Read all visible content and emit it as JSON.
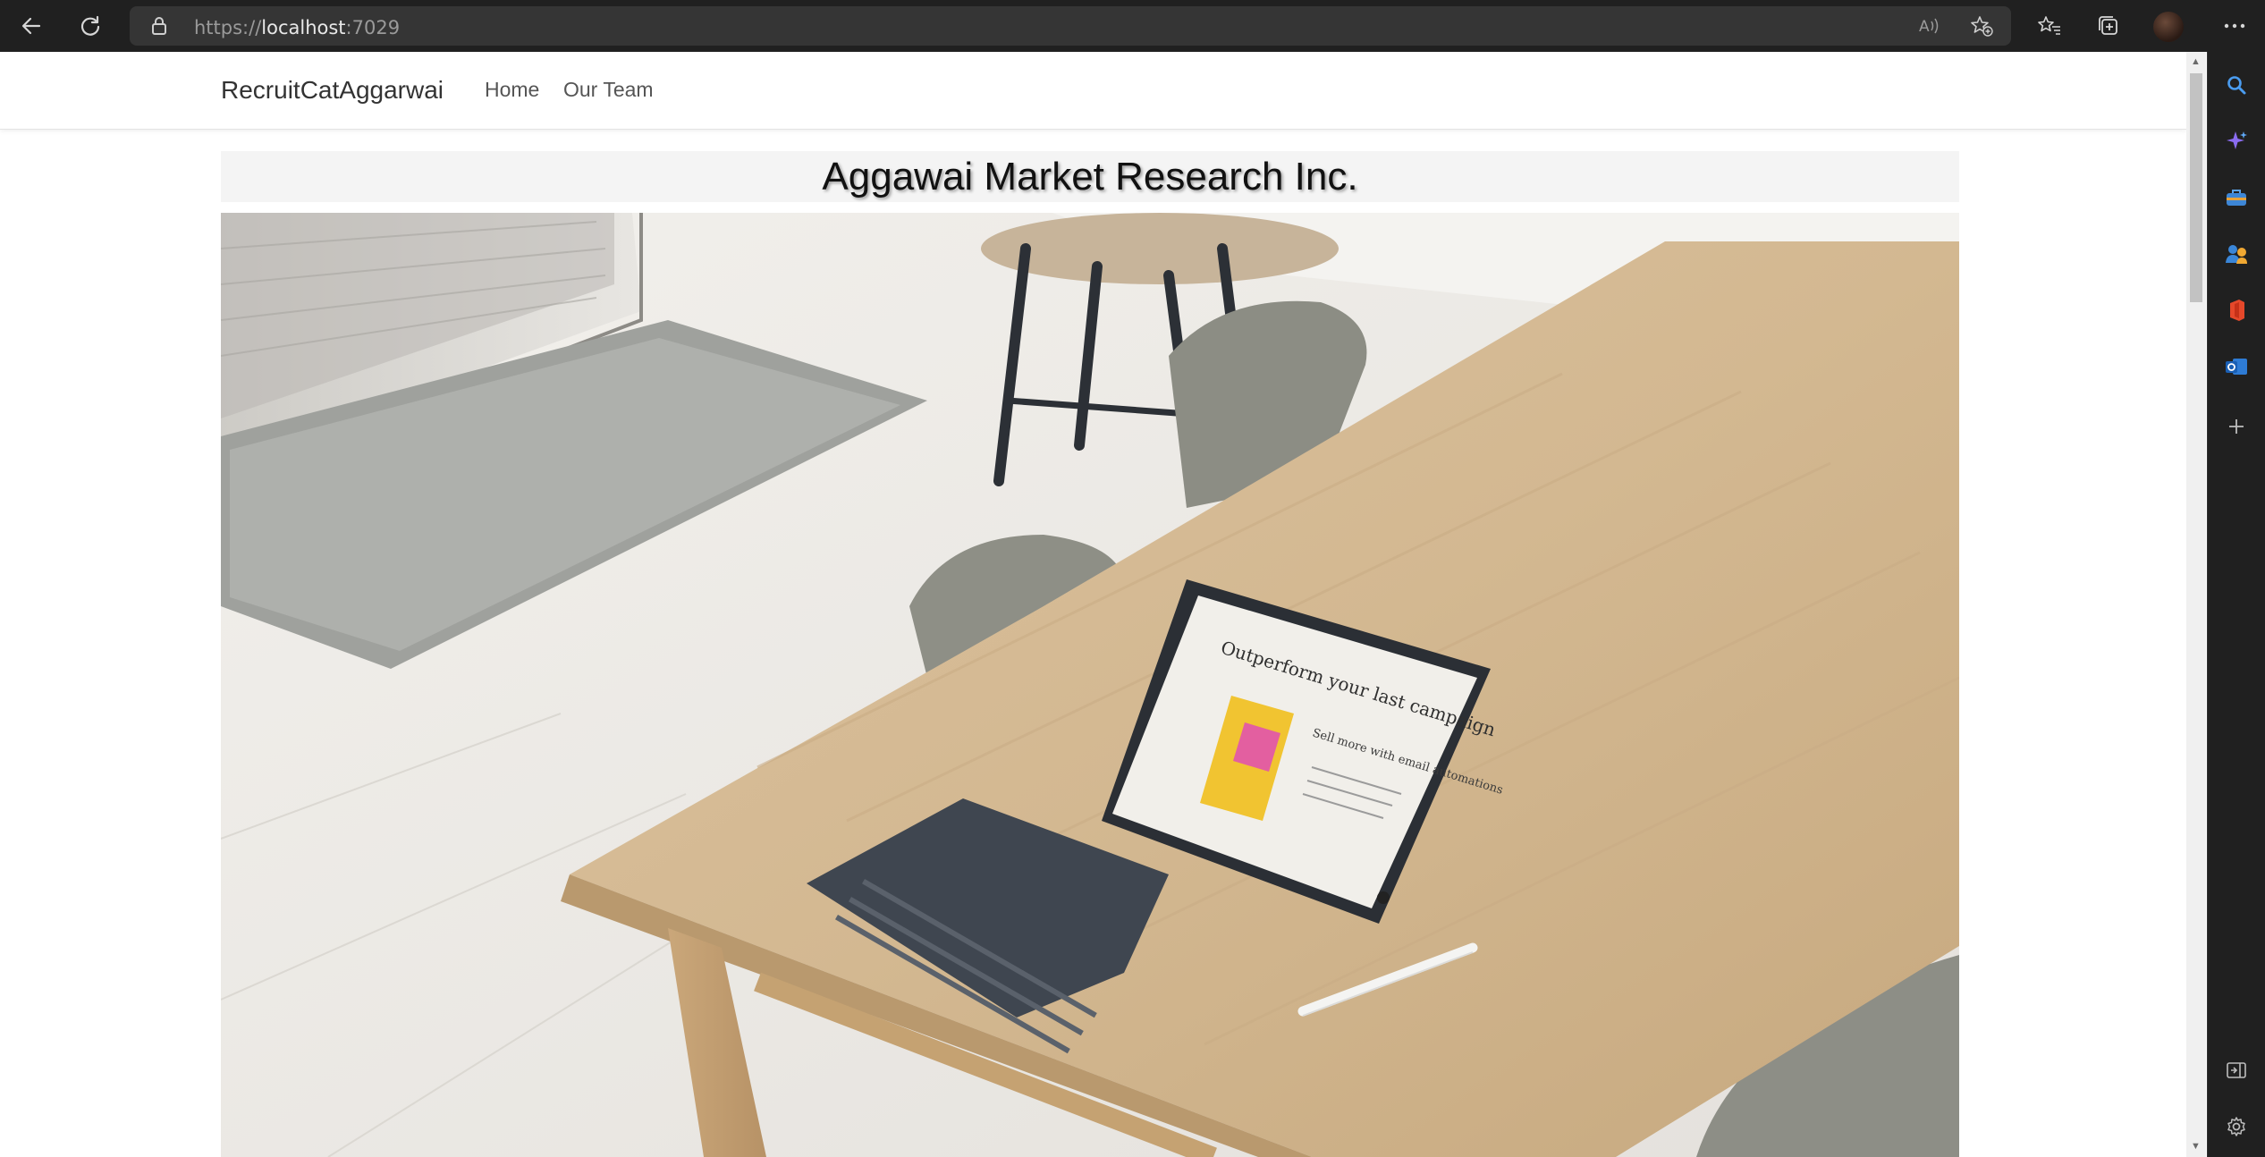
{
  "browser": {
    "url_scheme": "https://",
    "url_host": "localhost",
    "url_port": ":7029"
  },
  "site": {
    "brand": "RecruitCatAggarwai",
    "nav": [
      {
        "label": "Home"
      },
      {
        "label": "Our Team"
      }
    ]
  },
  "main": {
    "title": "Aggawai Market Research Inc.",
    "hero_image_icon": "photo-office-table-with-tablet",
    "tablet_screen": {
      "heading": "Outperform your last campaign",
      "subheading": "Sell more with email automations"
    }
  }
}
